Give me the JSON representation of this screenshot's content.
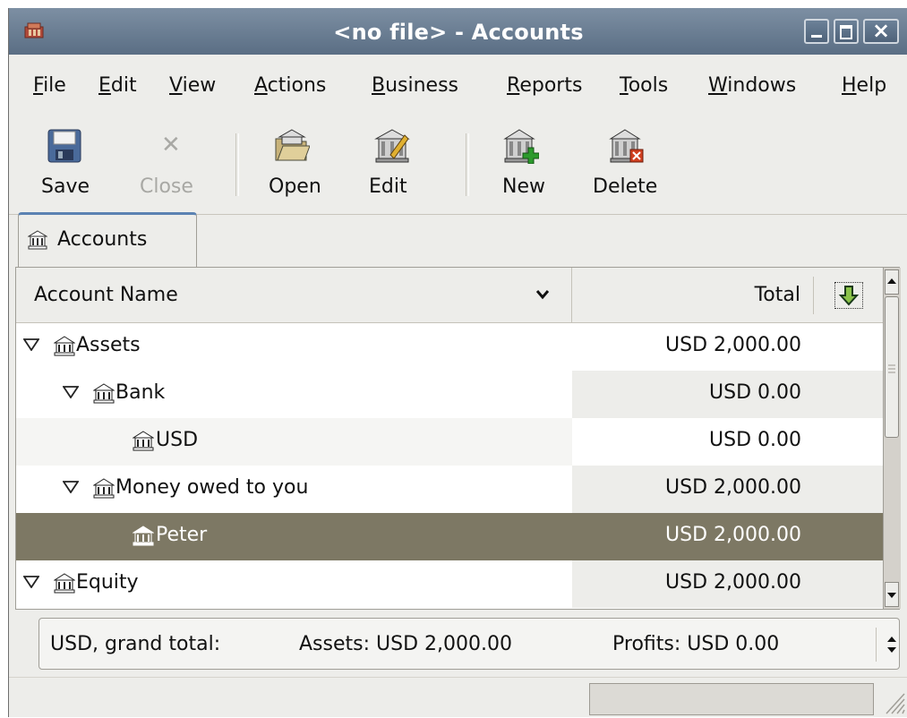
{
  "window": {
    "title": "<no file> - Accounts"
  },
  "menu": [
    {
      "label": "File",
      "u": "F",
      "rest": "ile"
    },
    {
      "label": "Edit",
      "u": "E",
      "rest": "dit"
    },
    {
      "label": "View",
      "u": "V",
      "rest": "iew"
    },
    {
      "label": "Actions",
      "u": "A",
      "rest": "ctions"
    },
    {
      "label": "Business",
      "u": "B",
      "rest": "usiness"
    },
    {
      "label": "Reports",
      "u": "R",
      "rest": "eports"
    },
    {
      "label": "Tools",
      "u": "T",
      "rest": "ools"
    },
    {
      "label": "Windows",
      "u": "W",
      "rest": "indows"
    },
    {
      "label": "Help",
      "u": "H",
      "rest": "elp"
    }
  ],
  "toolbar": {
    "save": "Save",
    "close": "Close",
    "open": "Open",
    "edit": "Edit",
    "new": "New",
    "delete": "Delete"
  },
  "tab": {
    "label": "Accounts"
  },
  "columns": {
    "name": "Account Name",
    "total": "Total"
  },
  "accounts": [
    {
      "name": "Assets",
      "total": "USD 2,000.00",
      "level": 0,
      "expanded": true
    },
    {
      "name": "Bank",
      "total": "USD 0.00",
      "level": 1,
      "expanded": true
    },
    {
      "name": "USD",
      "total": "USD 0.00",
      "level": 2,
      "expanded": null
    },
    {
      "name": "Money owed to you",
      "total": "USD 2,000.00",
      "level": 1,
      "expanded": true
    },
    {
      "name": "Peter",
      "total": "USD 2,000.00",
      "level": 2,
      "expanded": null,
      "selected": true
    },
    {
      "name": "Equity",
      "total": "USD 2,000.00",
      "level": 0,
      "expanded": true
    }
  ],
  "summary": {
    "currency": "USD, grand total:",
    "assets": "Assets: USD 2,000.00",
    "profits": "Profits: USD 0.00"
  },
  "colors": {
    "selection": "#7d7864",
    "titlebar": "#6b7f95",
    "tab_accent": "#5b82b2"
  }
}
